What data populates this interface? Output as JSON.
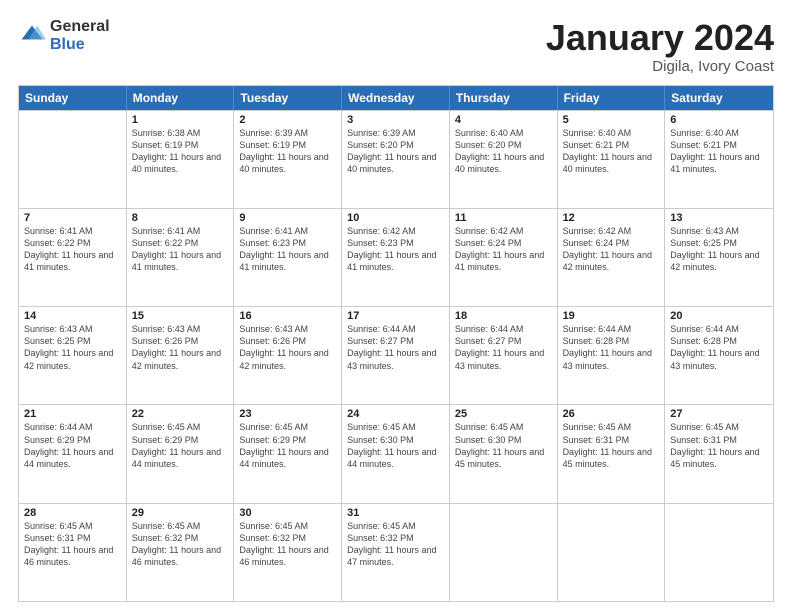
{
  "logo": {
    "general": "General",
    "blue": "Blue"
  },
  "title": {
    "month": "January 2024",
    "location": "Digila, Ivory Coast"
  },
  "header": {
    "days": [
      "Sunday",
      "Monday",
      "Tuesday",
      "Wednesday",
      "Thursday",
      "Friday",
      "Saturday"
    ]
  },
  "weeks": [
    [
      {
        "day": "",
        "sunrise": "",
        "sunset": "",
        "daylight": ""
      },
      {
        "day": "1",
        "sunrise": "Sunrise: 6:38 AM",
        "sunset": "Sunset: 6:19 PM",
        "daylight": "Daylight: 11 hours and 40 minutes."
      },
      {
        "day": "2",
        "sunrise": "Sunrise: 6:39 AM",
        "sunset": "Sunset: 6:19 PM",
        "daylight": "Daylight: 11 hours and 40 minutes."
      },
      {
        "day": "3",
        "sunrise": "Sunrise: 6:39 AM",
        "sunset": "Sunset: 6:20 PM",
        "daylight": "Daylight: 11 hours and 40 minutes."
      },
      {
        "day": "4",
        "sunrise": "Sunrise: 6:40 AM",
        "sunset": "Sunset: 6:20 PM",
        "daylight": "Daylight: 11 hours and 40 minutes."
      },
      {
        "day": "5",
        "sunrise": "Sunrise: 6:40 AM",
        "sunset": "Sunset: 6:21 PM",
        "daylight": "Daylight: 11 hours and 40 minutes."
      },
      {
        "day": "6",
        "sunrise": "Sunrise: 6:40 AM",
        "sunset": "Sunset: 6:21 PM",
        "daylight": "Daylight: 11 hours and 41 minutes."
      }
    ],
    [
      {
        "day": "7",
        "sunrise": "Sunrise: 6:41 AM",
        "sunset": "Sunset: 6:22 PM",
        "daylight": "Daylight: 11 hours and 41 minutes."
      },
      {
        "day": "8",
        "sunrise": "Sunrise: 6:41 AM",
        "sunset": "Sunset: 6:22 PM",
        "daylight": "Daylight: 11 hours and 41 minutes."
      },
      {
        "day": "9",
        "sunrise": "Sunrise: 6:41 AM",
        "sunset": "Sunset: 6:23 PM",
        "daylight": "Daylight: 11 hours and 41 minutes."
      },
      {
        "day": "10",
        "sunrise": "Sunrise: 6:42 AM",
        "sunset": "Sunset: 6:23 PM",
        "daylight": "Daylight: 11 hours and 41 minutes."
      },
      {
        "day": "11",
        "sunrise": "Sunrise: 6:42 AM",
        "sunset": "Sunset: 6:24 PM",
        "daylight": "Daylight: 11 hours and 41 minutes."
      },
      {
        "day": "12",
        "sunrise": "Sunrise: 6:42 AM",
        "sunset": "Sunset: 6:24 PM",
        "daylight": "Daylight: 11 hours and 42 minutes."
      },
      {
        "day": "13",
        "sunrise": "Sunrise: 6:43 AM",
        "sunset": "Sunset: 6:25 PM",
        "daylight": "Daylight: 11 hours and 42 minutes."
      }
    ],
    [
      {
        "day": "14",
        "sunrise": "Sunrise: 6:43 AM",
        "sunset": "Sunset: 6:25 PM",
        "daylight": "Daylight: 11 hours and 42 minutes."
      },
      {
        "day": "15",
        "sunrise": "Sunrise: 6:43 AM",
        "sunset": "Sunset: 6:26 PM",
        "daylight": "Daylight: 11 hours and 42 minutes."
      },
      {
        "day": "16",
        "sunrise": "Sunrise: 6:43 AM",
        "sunset": "Sunset: 6:26 PM",
        "daylight": "Daylight: 11 hours and 42 minutes."
      },
      {
        "day": "17",
        "sunrise": "Sunrise: 6:44 AM",
        "sunset": "Sunset: 6:27 PM",
        "daylight": "Daylight: 11 hours and 43 minutes."
      },
      {
        "day": "18",
        "sunrise": "Sunrise: 6:44 AM",
        "sunset": "Sunset: 6:27 PM",
        "daylight": "Daylight: 11 hours and 43 minutes."
      },
      {
        "day": "19",
        "sunrise": "Sunrise: 6:44 AM",
        "sunset": "Sunset: 6:28 PM",
        "daylight": "Daylight: 11 hours and 43 minutes."
      },
      {
        "day": "20",
        "sunrise": "Sunrise: 6:44 AM",
        "sunset": "Sunset: 6:28 PM",
        "daylight": "Daylight: 11 hours and 43 minutes."
      }
    ],
    [
      {
        "day": "21",
        "sunrise": "Sunrise: 6:44 AM",
        "sunset": "Sunset: 6:29 PM",
        "daylight": "Daylight: 11 hours and 44 minutes."
      },
      {
        "day": "22",
        "sunrise": "Sunrise: 6:45 AM",
        "sunset": "Sunset: 6:29 PM",
        "daylight": "Daylight: 11 hours and 44 minutes."
      },
      {
        "day": "23",
        "sunrise": "Sunrise: 6:45 AM",
        "sunset": "Sunset: 6:29 PM",
        "daylight": "Daylight: 11 hours and 44 minutes."
      },
      {
        "day": "24",
        "sunrise": "Sunrise: 6:45 AM",
        "sunset": "Sunset: 6:30 PM",
        "daylight": "Daylight: 11 hours and 44 minutes."
      },
      {
        "day": "25",
        "sunrise": "Sunrise: 6:45 AM",
        "sunset": "Sunset: 6:30 PM",
        "daylight": "Daylight: 11 hours and 45 minutes."
      },
      {
        "day": "26",
        "sunrise": "Sunrise: 6:45 AM",
        "sunset": "Sunset: 6:31 PM",
        "daylight": "Daylight: 11 hours and 45 minutes."
      },
      {
        "day": "27",
        "sunrise": "Sunrise: 6:45 AM",
        "sunset": "Sunset: 6:31 PM",
        "daylight": "Daylight: 11 hours and 45 minutes."
      }
    ],
    [
      {
        "day": "28",
        "sunrise": "Sunrise: 6:45 AM",
        "sunset": "Sunset: 6:31 PM",
        "daylight": "Daylight: 11 hours and 46 minutes."
      },
      {
        "day": "29",
        "sunrise": "Sunrise: 6:45 AM",
        "sunset": "Sunset: 6:32 PM",
        "daylight": "Daylight: 11 hours and 46 minutes."
      },
      {
        "day": "30",
        "sunrise": "Sunrise: 6:45 AM",
        "sunset": "Sunset: 6:32 PM",
        "daylight": "Daylight: 11 hours and 46 minutes."
      },
      {
        "day": "31",
        "sunrise": "Sunrise: 6:45 AM",
        "sunset": "Sunset: 6:32 PM",
        "daylight": "Daylight: 11 hours and 47 minutes."
      },
      {
        "day": "",
        "sunrise": "",
        "sunset": "",
        "daylight": ""
      },
      {
        "day": "",
        "sunrise": "",
        "sunset": "",
        "daylight": ""
      },
      {
        "day": "",
        "sunrise": "",
        "sunset": "",
        "daylight": ""
      }
    ]
  ]
}
